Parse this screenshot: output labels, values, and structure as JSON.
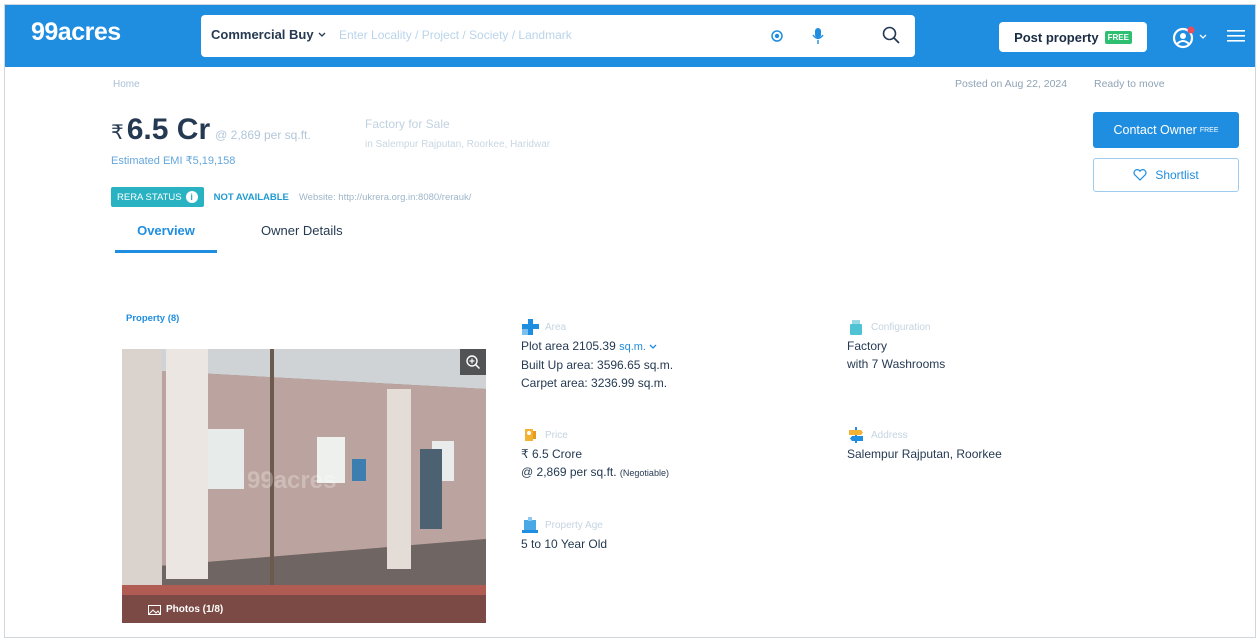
{
  "header": {
    "logo": "99acres",
    "search_type": "Commercial Buy",
    "search_placeholder": "Enter Locality / Project / Society / Landmark",
    "post_property": "Post property",
    "free_badge": "FREE"
  },
  "meta": {
    "home": "Home",
    "posted": "Posted on Aug 22, 2024",
    "ready": "Ready to move"
  },
  "listing": {
    "currency": "₹",
    "price": "6.5 Cr",
    "price_per_sqft": "@ 2,869 per sq.ft.",
    "emi": "Estimated EMI ₹5,19,158",
    "title": "Factory for Sale",
    "subtitle": "in Salempur Rajputan, Roorkee, Haridwar"
  },
  "rera": {
    "status_label": "RERA STATUS",
    "status_value": "NOT AVAILABLE",
    "website": "Website: http://ukrera.org.in:8080/rerauk/"
  },
  "actions": {
    "contact_owner": "Contact Owner",
    "contact_free": "FREE",
    "shortlist": "Shortlist"
  },
  "tabs": [
    {
      "label": "Overview",
      "active": true
    },
    {
      "label": "Owner Details",
      "active": false
    }
  ],
  "gallery": {
    "count_label": "Property (8)",
    "photos_label": "Photos (1/8)",
    "watermark": "99acres"
  },
  "details": {
    "area": {
      "label": "Area",
      "plot": "Plot area 2105.39",
      "plot_unit": "sq.m.",
      "built_up": "Built Up area: 3596.65 sq.m.",
      "carpet": "Carpet area: 3236.99 sq.m."
    },
    "configuration": {
      "label": "Configuration",
      "type": "Factory",
      "washrooms": "with 7 Washrooms"
    },
    "price": {
      "label": "Price",
      "value": "₹ 6.5 Crore",
      "per_sqft": "@ 2,869 per sq.ft.",
      "negotiable": "(Negotiable)"
    },
    "address": {
      "label": "Address",
      "value": "Salempur Rajputan, Roorkee"
    },
    "age": {
      "label": "Property Age",
      "value": "5 to 10 Year Old"
    }
  },
  "colors": {
    "brand_blue": "#1f8ee0",
    "rera_teal": "#29b3c2",
    "free_green": "#2fbf71"
  }
}
